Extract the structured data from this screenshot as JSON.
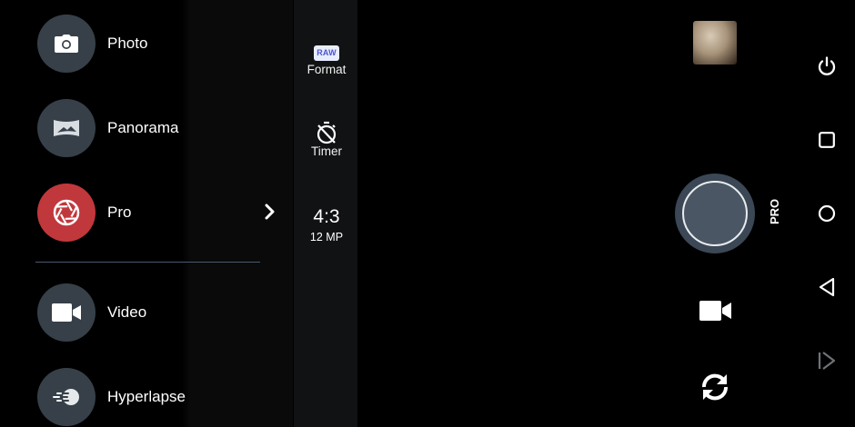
{
  "mode_menu": {
    "items": [
      {
        "label": "Photo",
        "icon": "camera-icon",
        "active": false
      },
      {
        "label": "Panorama",
        "icon": "panorama-icon",
        "active": false
      },
      {
        "label": "Pro",
        "icon": "aperture-icon",
        "active": true
      },
      {
        "label": "Video",
        "icon": "video-camera-icon",
        "active": false
      },
      {
        "label": "Hyperlapse",
        "icon": "hyperlapse-icon",
        "active": false
      }
    ]
  },
  "settings": {
    "format": {
      "badge": "RAW",
      "label": "Format"
    },
    "timer": {
      "label": "Timer",
      "icon": "timer-off-icon"
    },
    "aspect_ratio": {
      "ratio": "4:3",
      "resolution": "12 MP"
    }
  },
  "controls": {
    "mode_tag": "PRO",
    "shutter": "shutter-button",
    "video_switch": "video-camera-icon",
    "flip_camera": "switch-camera-icon",
    "gallery_thumbnail": "last-photo-thumbnail"
  },
  "navigation": [
    "power-icon",
    "recents-square-icon",
    "home-circle-icon",
    "back-triangle-icon",
    "forward-bar-icon"
  ],
  "colors": {
    "active_mode": "#c0383c",
    "mode_circle": "#374049",
    "divider": "#4a5a6c",
    "settings_bg": "#111214",
    "shutter_ring": "#3b4754"
  }
}
